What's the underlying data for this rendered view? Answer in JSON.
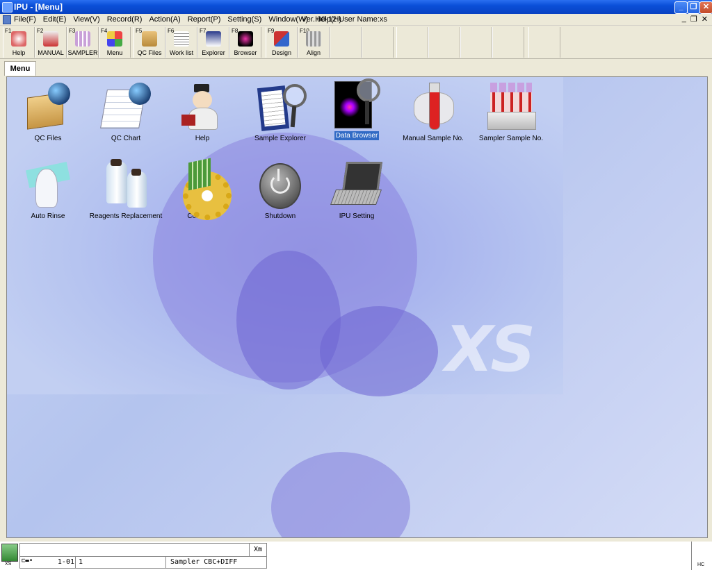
{
  "window": {
    "title": "IPU - [Menu]"
  },
  "menubar": {
    "items": [
      "File(F)",
      "Edit(E)",
      "View(V)",
      "Record(R)",
      "Action(A)",
      "Report(P)",
      "Setting(S)",
      "Window(W)",
      "Help(H)"
    ],
    "version_text": "Ver.:00-12 User Name:xs"
  },
  "toolbar": {
    "buttons": [
      {
        "fkey": "F1",
        "label": "Help"
      },
      {
        "fkey": "F2",
        "label": "MANUAL"
      },
      {
        "fkey": "F3",
        "label": "SAMPLER"
      },
      {
        "fkey": "F4",
        "label": "Menu"
      },
      {
        "fkey": "F5",
        "label": "QC Files"
      },
      {
        "fkey": "F6",
        "label": "Work list"
      },
      {
        "fkey": "F7",
        "label": "Explorer"
      },
      {
        "fkey": "F8",
        "label": "Browser"
      },
      {
        "fkey": "F9",
        "label": "Design"
      },
      {
        "fkey": "F10",
        "label": "Align"
      }
    ]
  },
  "tabs": {
    "active": "Menu"
  },
  "desktop": {
    "icons": [
      {
        "label": "QC Files",
        "icon": "folder-globe-icon"
      },
      {
        "label": "QC Chart",
        "icon": "chart-globe-icon"
      },
      {
        "label": "Help",
        "icon": "doctor-book-icon"
      },
      {
        "label": "Sample Explorer",
        "icon": "clipboard-magnifier-icon"
      },
      {
        "label": "Data Browser",
        "icon": "scattergram-magnifier-icon"
      },
      {
        "label": "Manual Sample No.",
        "icon": "hand-tube-icon"
      },
      {
        "label": "Sampler Sample No.",
        "icon": "tube-rack-icon"
      },
      {
        "label": "Auto Rinse",
        "icon": "gloves-icon"
      },
      {
        "label": "Reagents Replacement",
        "icon": "reagent-bottles-icon"
      },
      {
        "label": "Controller",
        "icon": "gears-chip-icon"
      },
      {
        "label": "Shutdown",
        "icon": "power-icon"
      },
      {
        "label": "IPU Setting",
        "icon": "laptop-icon"
      }
    ],
    "selected": "Data Browser",
    "watermark": "XS"
  },
  "statusbar": {
    "left_label": "XS",
    "xm_label": "Xm",
    "rack_position": "1-01",
    "tube_number": "1",
    "mode": "Sampler CBC+DIFF",
    "right_code": "HC"
  }
}
